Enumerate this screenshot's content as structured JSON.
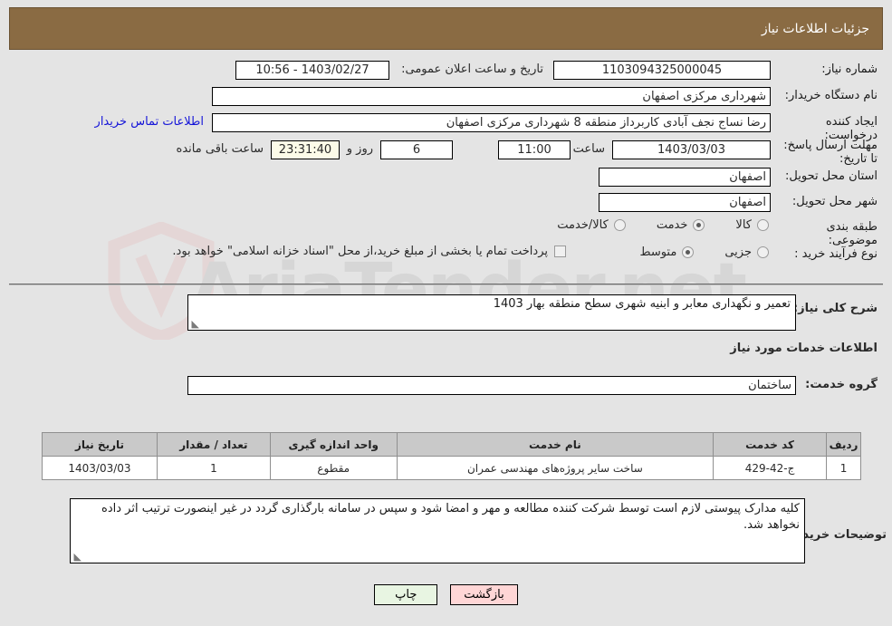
{
  "header": {
    "title": "جزئیات اطلاعات نیاز"
  },
  "top": {
    "need_number_label": "شماره نیاز:",
    "need_number_value": "1103094325000045",
    "announce_label": "تاریخ و ساعت اعلان عمومی:",
    "announce_value": "1403/02/27 - 10:56",
    "buyer_org_label": "نام دستگاه خریدار:",
    "buyer_org_value": "شهرداری مرکزی اصفهان",
    "creator_label": "ایجاد کننده درخواست:",
    "creator_value": "رضا نساج نجف آبادی کاربرداز منطقه 8 شهرداری مرکزی اصفهان",
    "contact_link": "اطلاعات تماس خریدار",
    "deadline_label": "مهلت ارسال پاسخ: تا تاریخ:",
    "deadline_date": "1403/03/03",
    "deadline_hour_label": "ساعت",
    "deadline_hour": "11:00",
    "remaining_days": "6",
    "remaining_days_label": "روز و",
    "remaining_time": "23:31:40",
    "remaining_suffix": "ساعت باقی مانده",
    "province_label": "استان محل تحویل:",
    "province_value": "اصفهان",
    "city_label": "شهر محل تحویل:",
    "city_value": "اصفهان",
    "classification_label": "طبقه بندی موضوعی:",
    "classification_options": [
      {
        "label": "کالا",
        "selected": false
      },
      {
        "label": "خدمت",
        "selected": true
      },
      {
        "label": "کالا/خدمت",
        "selected": false
      }
    ],
    "process_type_label": "نوع فرآیند خرید :",
    "process_type_options": [
      {
        "label": "جزیی",
        "selected": false
      },
      {
        "label": "متوسط",
        "selected": true
      }
    ],
    "treasury_checkbox_checked": false,
    "treasury_note": "پرداخت تمام یا بخشی از مبلغ خرید،از محل \"اسناد خزانه اسلامی\" خواهد بود."
  },
  "middle": {
    "general_desc_label": "شرح کلی نیاز:",
    "general_desc_value": "تعمیر و نگهداری معابر و ابنیه شهری سطح منطقه بهار 1403",
    "services_info_heading": "اطلاعات خدمات مورد نیاز",
    "service_group_label": "گروه خدمت:",
    "service_group_value": "ساختمان"
  },
  "table": {
    "columns": [
      "ردیف",
      "کد خدمت",
      "نام خدمت",
      "واحد اندازه گیری",
      "تعداد / مقدار",
      "تاریخ نیاز"
    ],
    "rows": [
      {
        "index": "1",
        "service_code": "ج-42-429",
        "service_name": "ساخت سایر پروژه‌های مهندسی عمران",
        "unit": "مقطوع",
        "quantity": "1",
        "need_date": "1403/03/03"
      }
    ]
  },
  "notes": {
    "label": "توضیحات خریدار:",
    "value": "کلیه مدارک پیوستی لازم است توسط شرکت کننده مطالعه و مهر و امضا شود و سپس در سامانه بارگذاری گردد در غیر اینصورت ترتیب اثر داده نخواهد شد."
  },
  "buttons": {
    "print": "چاپ",
    "back": "بازگشت"
  },
  "watermark": {
    "text": "AriaTender.net"
  },
  "colors": {
    "header_bg": "#8a6b43",
    "page_bg": "#e4e4e4",
    "link": "#1414d8",
    "table_header_bg": "#c9c9c9",
    "back_button_bg": "#ffd6d6",
    "print_button_bg": "#e8f5e2",
    "cream_field_bg": "#fcfbe8"
  }
}
